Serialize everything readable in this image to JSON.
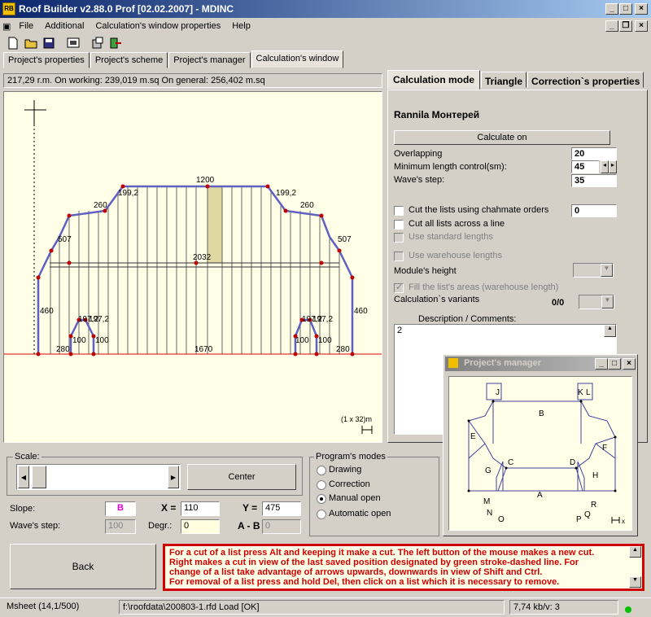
{
  "window": {
    "title": "Roof Builder v2.88.0 Prof   [02.02.2007]  - MDINC",
    "app_icon_text": "RB"
  },
  "menu": [
    "File",
    "Additional",
    "Calculation's window properties",
    "Help"
  ],
  "toolbar": [
    "new-icon",
    "open-icon",
    "save-icon",
    "print-preview-icon",
    "properties-icon",
    "export-icon"
  ],
  "tabs": [
    "Project's properties",
    "Project's scheme",
    "Project's manager",
    "Calculation's window"
  ],
  "info_bar": "217,29 r.m. On working:  239,019 m.sq On general:  256,402 m.sq",
  "drawing": {
    "dims": {
      "top": "1200",
      "upper_left": "199,2",
      "upper_right": "199,2",
      "mid_left": "260",
      "mid_right": "260",
      "side_left": "507",
      "side_right": "507",
      "center": "2032",
      "vert_left": "460",
      "vert_right": "460",
      "dormer_left": "197,2",
      "dormer_left2": "197,2",
      "dormer_right": "197,2",
      "dormer_right2": "197,2",
      "d100a": "100",
      "d100b": "100",
      "d100c": "100",
      "d100d": "100",
      "base_left": "280",
      "base_right": "280",
      "bottom": "1670"
    },
    "scale_note": "(1 x 32)m"
  },
  "right_panel": {
    "tabs": [
      "Calculation mode",
      "Triangle",
      "Correction`s properties"
    ],
    "title": "Rannila Монтерей",
    "calculate_button": "Calculate on",
    "overlapping_label": "Overlapping",
    "overlapping_value": "20",
    "min_length_label": "Minimum length control(sm):",
    "min_length_value": "45",
    "wave_step_label": "Wave's step:",
    "wave_step_value": "35",
    "cut_chahmate_label": "Cut the lists using chahmate orders",
    "cut_chahmate_value": "0",
    "cut_all_label": "Cut all lists across a line",
    "standard_lengths_label": "Use standard lengths",
    "warehouse_lengths_label": "Use warehouse lengths",
    "module_height_label": "Module's height",
    "fill_areas_label": "Fill the list's areas (warehouse length)",
    "variants_label": "Calculation`s variants",
    "variants_value": "0/0",
    "description_label": "Description / Comments:",
    "description_value": "2"
  },
  "manager": {
    "title": "Project's manager",
    "labels": [
      "J",
      "K",
      "L",
      "B",
      "E",
      "C",
      "D",
      "F",
      "G",
      "H",
      "A",
      "M",
      "N",
      "O",
      "P",
      "Q",
      "R"
    ],
    "corner": "x"
  },
  "scale": {
    "label": "Scale:",
    "center_button": "Center"
  },
  "slope": {
    "label": "Slope:",
    "value": "B"
  },
  "wave": {
    "label": "Wave's step:",
    "value": "100"
  },
  "coords": {
    "x_label": "X =",
    "x_value": "110",
    "y_label": "Y =",
    "y_value": "475",
    "degr_label": "Degr.:",
    "degr_value": "0",
    "ab_label": "A - B",
    "ab_value": "0"
  },
  "modes": {
    "title": "Program's modes",
    "options": [
      "Drawing",
      "Correction",
      "Manual open",
      "Automatic open"
    ],
    "selected": "Manual open"
  },
  "back_button": "Back",
  "help_text": [
    "For a cut of a list press Alt and keeping it make a cut. The left button of the mouse makes a new cut.",
    "Right makes a cut in view of the last saved position designated by green stroke-dashed line. For",
    "change of a list take advantage of arrows upwards, downwards in view of Shift and Ctrl.",
    "For removal of a list press and hold Del, then click on a list which it is necessary to remove."
  ],
  "status": {
    "sheet": "Msheet (14,1/500)",
    "file": "f:\\roofdata\\200803-1.rfd Load [OK]",
    "speed": "7,74 kb/v: 3"
  },
  "colors": {
    "title_start": "#0a246a",
    "title_end": "#a6caf0",
    "help_red": "#d00000",
    "slope_magenta": "#e000e0",
    "canvas": "#ffffe8",
    "roof_line": "#3030a0",
    "accent_sheet": "#e0d8a0"
  }
}
